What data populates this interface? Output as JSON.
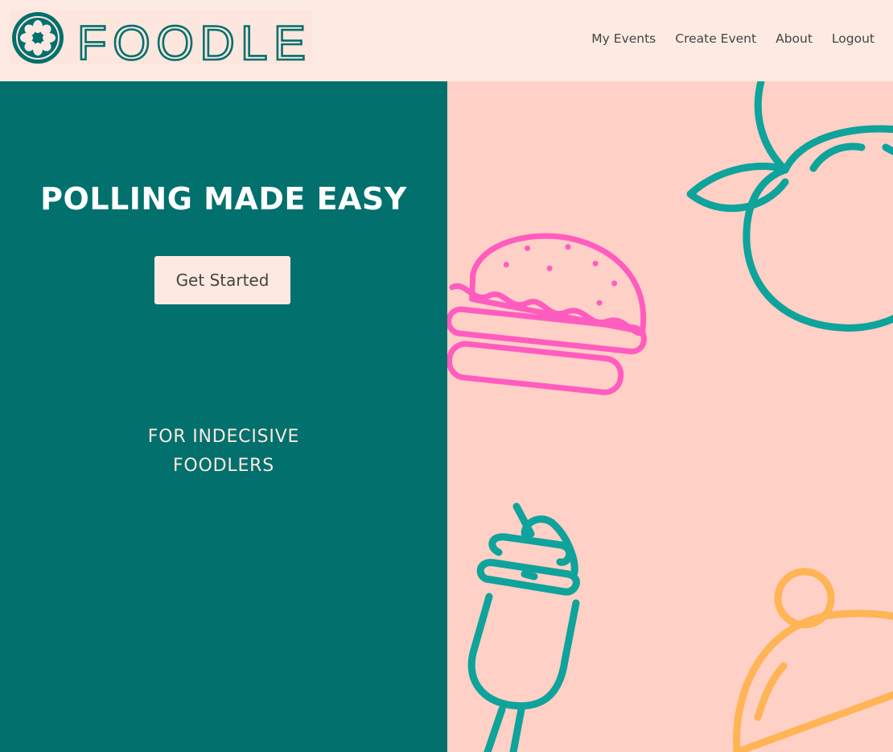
{
  "brand": {
    "name": "FOODLE",
    "colors": {
      "teal": "#02706d",
      "icon_teal": "#0ea39b",
      "pink": "#ff5cc0",
      "orange": "#ffb455",
      "cream": "#fde9e1",
      "peach": "#ffd0c5"
    }
  },
  "nav": {
    "links": [
      {
        "label": "My Events"
      },
      {
        "label": "Create Event"
      },
      {
        "label": "About"
      },
      {
        "label": "Logout"
      }
    ]
  },
  "hero": {
    "headline": "POLLING MADE EASY",
    "cta_label": "Get Started",
    "tagline_line1": "FOR INDECISIVE",
    "tagline_line2": "FOODLERS"
  },
  "illustrations": [
    "peach-icon",
    "burger-icon",
    "milkshake-icon",
    "cloche-icon"
  ]
}
